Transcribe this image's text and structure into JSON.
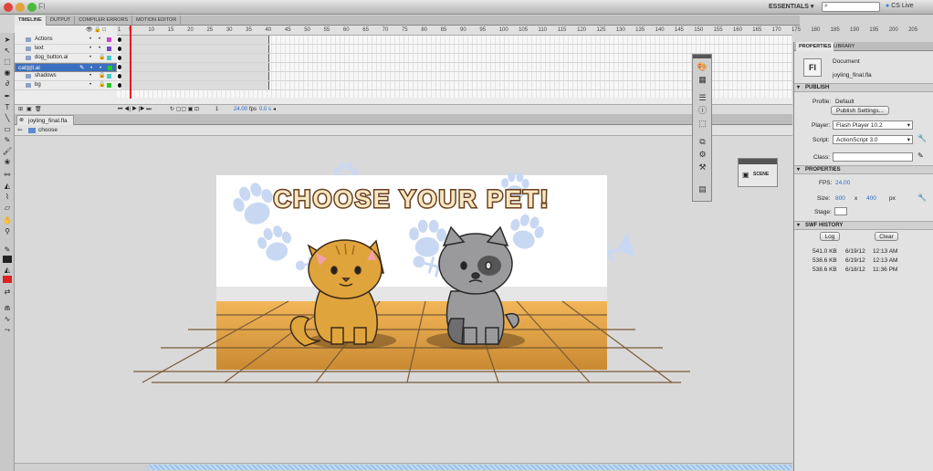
{
  "window": {
    "title": "Fl",
    "essentials": "ESSENTIALS ▾",
    "search_placeholder": "",
    "cs_live": "CS Live"
  },
  "panel_tabs": [
    "TIMELINE",
    "OUTPUT",
    "COMPILER ERRORS",
    "MOTION EDITOR"
  ],
  "timeline": {
    "ruler": [
      "1",
      "5",
      "10",
      "15",
      "20",
      "25",
      "30",
      "35",
      "40",
      "45",
      "50",
      "55",
      "60",
      "65",
      "70",
      "75",
      "80",
      "85",
      "90",
      "95",
      "100",
      "105",
      "110",
      "115",
      "120",
      "125",
      "130",
      "135",
      "140",
      "145",
      "150",
      "155",
      "160",
      "165",
      "170",
      "175",
      "180",
      "185",
      "190",
      "195",
      "200",
      "205"
    ],
    "layers": [
      {
        "name": "Actions",
        "color": "#cc44cc"
      },
      {
        "name": "text",
        "color": "#7744cc"
      },
      {
        "name": "dog_button.ai",
        "color": "#44cccc"
      },
      {
        "name": "cattail.ai",
        "color": "#22cc22",
        "selected": true
      },
      {
        "name": "shadows",
        "color": "#44cccc"
      },
      {
        "name": "bg",
        "color": "#22cc22"
      }
    ],
    "current_frame": "1",
    "fps": "24.00",
    "fps_unit": "fps",
    "time": "0.0 s"
  },
  "document": {
    "tab": "joyling_final.fla",
    "breadcrumb": "choose"
  },
  "stage": {
    "title": "CHOOSE YOUR PET!"
  },
  "scene_panel": {
    "label": "SCENE"
  },
  "properties": {
    "tabs": [
      "PROPERTIES",
      "LIBRARY"
    ],
    "doc_icon": "Fl",
    "doc_type": "Document",
    "doc_name": "joyling_final.fla",
    "publish": {
      "header": "PUBLISH",
      "profile_label": "Profile:",
      "profile_value": "Default",
      "settings_btn": "Publish Settings...",
      "player_label": "Player:",
      "player_value": "Flash Player 10.2",
      "script_label": "Script:",
      "script_value": "ActionScript 3.0",
      "class_label": "Class:"
    },
    "props": {
      "header": "PROPERTIES",
      "fps_label": "FPS:",
      "fps_value": "24.00",
      "size_label": "Size:",
      "width": "800",
      "x": "x",
      "height": "400",
      "unit": "px",
      "stage_label": "Stage:"
    },
    "history": {
      "header": "SWF HISTORY",
      "log_btn": "Log",
      "clear_btn": "Clear",
      "rows": [
        {
          "size": "541.0 KB",
          "date": "6/19/12",
          "time": "12:13 AM"
        },
        {
          "size": "538.6 KB",
          "date": "6/19/12",
          "time": "12:13 AM"
        },
        {
          "size": "538.6 KB",
          "date": "6/18/12",
          "time": "11:36 PM"
        }
      ]
    }
  },
  "colors": {
    "selected_layer": "#3b6fbf",
    "playhead": "#e12222",
    "title_fill": "#f6e7c3",
    "title_stroke": "#6b3f1d",
    "floor": "#e9a84a",
    "paw": "#c9d8f2",
    "cat": "#e0a43c",
    "dog": "#9a9a9c"
  }
}
